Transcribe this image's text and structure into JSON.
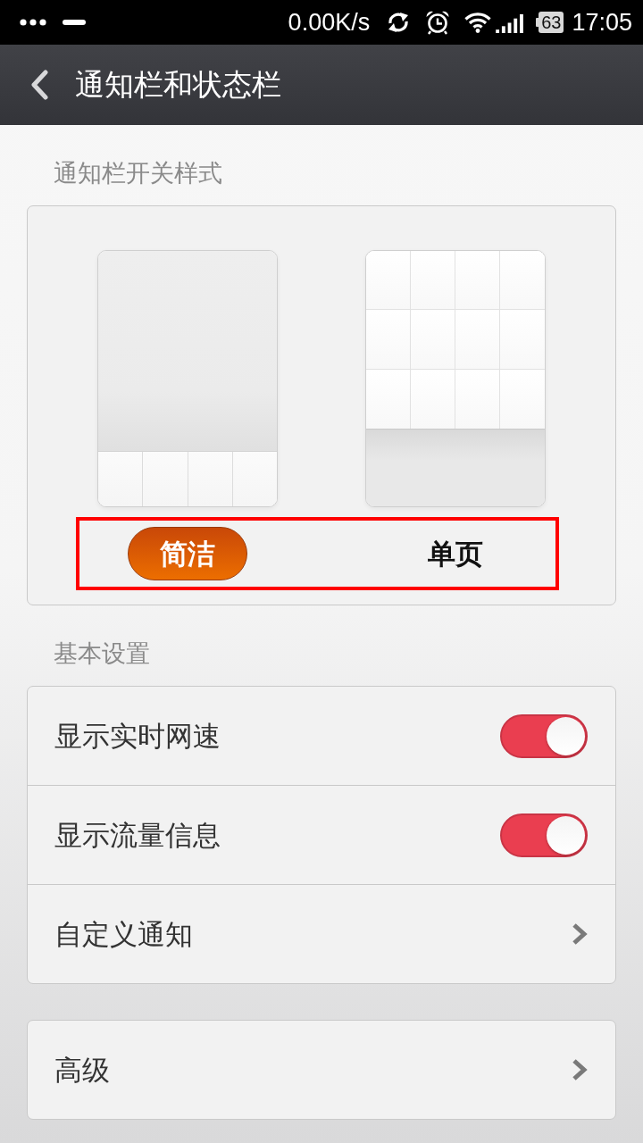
{
  "status_bar": {
    "network_speed": "0.00K/s",
    "battery": "63",
    "time": "17:05"
  },
  "title_bar": {
    "title": "通知栏和状态栏"
  },
  "style_picker": {
    "header": "通知栏开关样式",
    "highlighted": true,
    "options": [
      {
        "label": "简洁",
        "kind": "row",
        "selected": true
      },
      {
        "label": "单页",
        "kind": "grid",
        "selected": false
      }
    ]
  },
  "groups": [
    {
      "header": "基本设置",
      "rows": [
        {
          "kind": "toggle",
          "label": "显示实时网速",
          "on": true
        },
        {
          "kind": "toggle",
          "label": "显示流量信息",
          "on": true
        },
        {
          "kind": "link",
          "label": "自定义通知"
        }
      ]
    },
    {
      "rows": [
        {
          "kind": "link",
          "label": "高级"
        }
      ]
    }
  ]
}
